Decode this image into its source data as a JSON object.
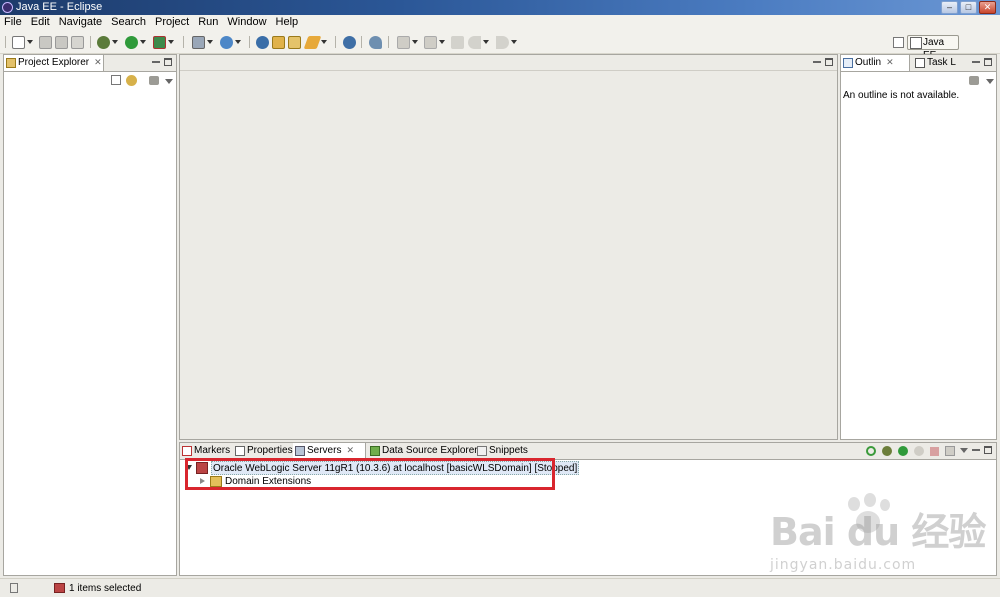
{
  "window": {
    "title": "Java EE - Eclipse"
  },
  "menubar": [
    "File",
    "Edit",
    "Navigate",
    "Search",
    "Project",
    "Run",
    "Window",
    "Help"
  ],
  "perspective": {
    "label": "Java EE"
  },
  "project_explorer": {
    "tab_label": "Project Explorer"
  },
  "outline": {
    "tab_label": "Outlin",
    "task_tab_label": "Task L",
    "message": "An outline is not available."
  },
  "bottom_tabs": {
    "markers": "Markers",
    "properties": "Properties",
    "servers": "Servers",
    "datasource": "Data Source Explorer",
    "snippets": "Snippets"
  },
  "servers": {
    "server_entry": "Oracle WebLogic Server 11gR1 (10.3.6) at localhost [basicWLSDomain]  [Stopped]",
    "child_entry": "Domain Extensions"
  },
  "statusbar": {
    "selection": "1 items selected"
  },
  "watermark": {
    "brand": "Bai  du 经验",
    "url": "jingyan.baidu.com"
  },
  "colors": {
    "highlight": "#d9262e",
    "title_gradient_start": "#1d3b6b",
    "title_gradient_end": "#6b97d4"
  }
}
